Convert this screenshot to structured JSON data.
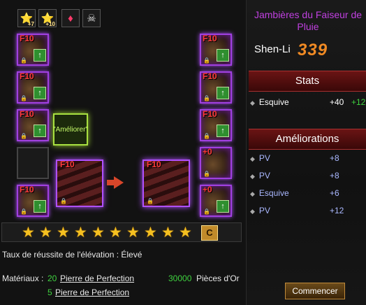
{
  "top_icons": [
    {
      "icon": "star-icon",
      "sub": "+7"
    },
    {
      "icon": "star-icon",
      "sub": "+10"
    },
    {
      "icon": "gem-icon",
      "sub": ""
    },
    {
      "icon": "skull-icon",
      "sub": ""
    }
  ],
  "left_slots": [
    {
      "level": "F10"
    },
    {
      "level": "F10"
    },
    {
      "level": "F10"
    },
    {
      "level": ""
    },
    {
      "level": "F10"
    }
  ],
  "right_slots": [
    {
      "level": "F10"
    },
    {
      "level": "F10"
    },
    {
      "level": "F10"
    },
    {
      "level": "+0"
    },
    {
      "level": "+0"
    }
  ],
  "ameliorer_label": "\"Améliorer\"",
  "source_item": {
    "level": "F10"
  },
  "target_item": {
    "level": "F10"
  },
  "stars": {
    "count": 10
  },
  "reset_button": "C",
  "success_rate": "Taux de réussite de l'élévation : Élevé",
  "materials": {
    "label": "Matériaux :",
    "row1_qty": "20",
    "row1_item": "Pierre de Perfection",
    "row2_qty": "5",
    "row2_item": "Pierre de Perfection",
    "gold_qty": "30000",
    "gold_label": "Pièces d'Or"
  },
  "item_title": "Jambières du Faiseur de Pluie",
  "character_name": "Shen-Li",
  "power": "339",
  "stats_header": "Stats",
  "stats": [
    {
      "name": "Esquive",
      "value": "+40",
      "bonus": "+12"
    }
  ],
  "upgrades_header": "Améliorations",
  "upgrades": [
    {
      "name": "PV",
      "value": "+8",
      "color": "#aab8ff"
    },
    {
      "name": "PV",
      "value": "+8",
      "color": "#aab8ff"
    },
    {
      "name": "Esquive",
      "value": "+6",
      "color": "#aab8ff"
    },
    {
      "name": "PV",
      "value": "+12",
      "color": "#aab8ff"
    }
  ],
  "start_button": "Commencer"
}
